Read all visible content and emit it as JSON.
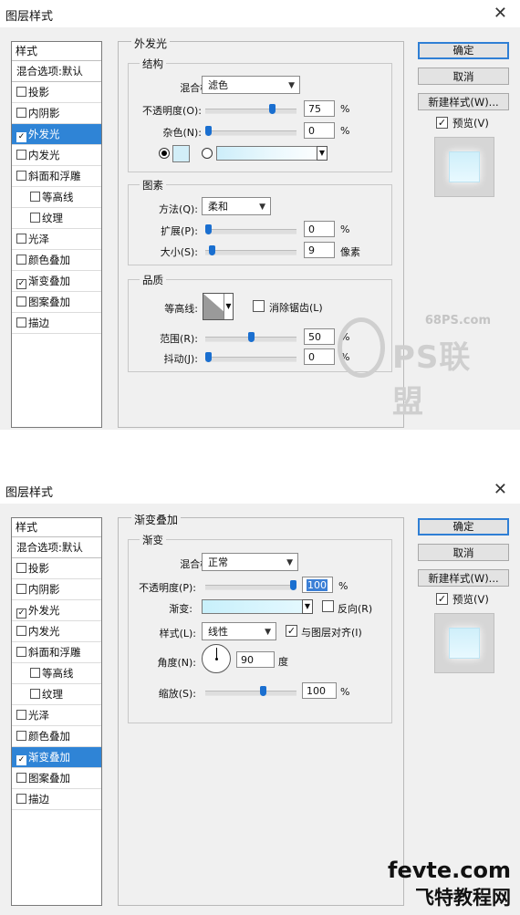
{
  "dialog1": {
    "title": "图层样式",
    "close": "✕",
    "styles_header": "样式",
    "styles": [
      {
        "label": "混合选项:默认",
        "checkbox": false
      },
      {
        "label": "投影",
        "checkbox": true,
        "checked": false
      },
      {
        "label": "内阴影",
        "checkbox": true,
        "checked": false
      },
      {
        "label": "外发光",
        "checkbox": true,
        "checked": true,
        "selected": true
      },
      {
        "label": "内发光",
        "checkbox": true,
        "checked": false
      },
      {
        "label": "斜面和浮雕",
        "checkbox": true,
        "checked": false
      },
      {
        "label": "等高线",
        "checkbox": true,
        "checked": false,
        "sub": true
      },
      {
        "label": "纹理",
        "checkbox": true,
        "checked": false,
        "sub": true
      },
      {
        "label": "光泽",
        "checkbox": true,
        "checked": false
      },
      {
        "label": "颜色叠加",
        "checkbox": true,
        "checked": false
      },
      {
        "label": "渐变叠加",
        "checkbox": true,
        "checked": true
      },
      {
        "label": "图案叠加",
        "checkbox": true,
        "checked": false
      },
      {
        "label": "描边",
        "checkbox": true,
        "checked": false
      }
    ],
    "panel_title": "外发光",
    "structure": {
      "title": "结构",
      "blend_mode_label": "混合模式:",
      "blend_mode": "滤色",
      "opacity_label": "不透明度(O):",
      "opacity": "75",
      "opacity_fraction": 0.75,
      "noise_label": "杂色(N):",
      "noise": "0",
      "noise_fraction": 0.0,
      "unit": "%",
      "color": "#d2eef8"
    },
    "elements": {
      "title": "图素",
      "method_label": "方法(Q):",
      "method": "柔和",
      "spread_label": "扩展(P):",
      "spread": "0",
      "spread_fraction": 0.0,
      "size_label": "大小(S):",
      "size": "9",
      "size_fraction": 0.04,
      "spread_unit": "%",
      "size_unit": "像素"
    },
    "quality": {
      "title": "品质",
      "contour_label": "等高线:",
      "antialias_label": "消除锯齿(L)",
      "range_label": "范围(R):",
      "range": "50",
      "range_fraction": 0.5,
      "jitter_label": "抖动(J):",
      "jitter": "0",
      "jitter_fraction": 0.0,
      "unit": "%"
    },
    "buttons": {
      "ok": "确定",
      "cancel": "取消",
      "new_style": "新建样式(W)...",
      "preview": "预览(V)"
    },
    "watermark": {
      "site": "68PS.com",
      "brand": "PS联盟"
    }
  },
  "dialog2": {
    "title": "图层样式",
    "close": "✕",
    "styles_header": "样式",
    "styles": [
      {
        "label": "混合选项:默认",
        "checkbox": false
      },
      {
        "label": "投影",
        "checkbox": true,
        "checked": false
      },
      {
        "label": "内阴影",
        "checkbox": true,
        "checked": false
      },
      {
        "label": "外发光",
        "checkbox": true,
        "checked": true
      },
      {
        "label": "内发光",
        "checkbox": true,
        "checked": false
      },
      {
        "label": "斜面和浮雕",
        "checkbox": true,
        "checked": false
      },
      {
        "label": "等高线",
        "checkbox": true,
        "checked": false,
        "sub": true
      },
      {
        "label": "纹理",
        "checkbox": true,
        "checked": false,
        "sub": true
      },
      {
        "label": "光泽",
        "checkbox": true,
        "checked": false
      },
      {
        "label": "颜色叠加",
        "checkbox": true,
        "checked": false
      },
      {
        "label": "渐变叠加",
        "checkbox": true,
        "checked": true,
        "selected": true
      },
      {
        "label": "图案叠加",
        "checkbox": true,
        "checked": false
      },
      {
        "label": "描边",
        "checkbox": true,
        "checked": false
      }
    ],
    "panel_title": "渐变叠加",
    "gradient": {
      "title": "渐变",
      "blend_mode_label": "混合模式:",
      "blend_mode": "正常",
      "opacity_label": "不透明度(P):",
      "opacity": "100",
      "opacity_fraction": 1.0,
      "unit": "%",
      "gradient_label": "渐变:",
      "reverse_label": "反向(R)",
      "style_label": "样式(L):",
      "style": "线性",
      "align_label": "与图层对齐(I)",
      "angle_label": "角度(N):",
      "angle": "90",
      "angle_unit": "度",
      "scale_label": "缩放(S):",
      "scale": "100",
      "scale_fraction": 0.65
    },
    "buttons": {
      "ok": "确定",
      "cancel": "取消",
      "new_style": "新建样式(W)...",
      "preview": "预览(V)"
    },
    "watermark": {
      "site": "fevte.com",
      "brand": "飞特教程网"
    }
  }
}
